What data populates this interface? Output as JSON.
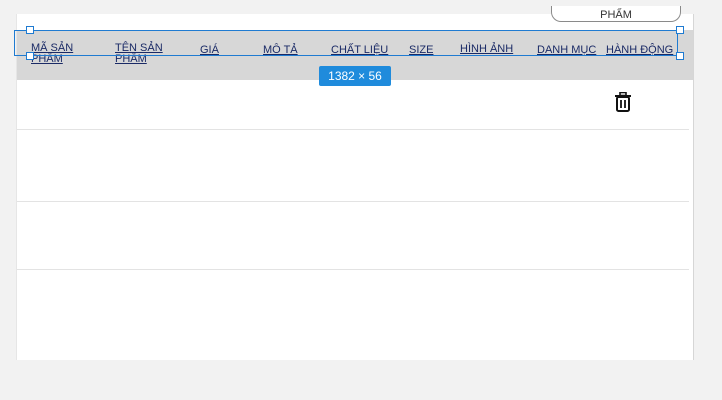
{
  "top_button": {
    "label": "PHẨM"
  },
  "table": {
    "headers": [
      {
        "label": "MÃ SẢN PHẨM"
      },
      {
        "label": "TÊN SẢN PHẨM"
      },
      {
        "label": "GIÁ"
      },
      {
        "label": "MÔ TẢ"
      },
      {
        "label": "CHẤT LIỆU"
      },
      {
        "label": "SIZE"
      },
      {
        "label": "HÌNH ẢNH"
      },
      {
        "label": "DANH MỤC"
      },
      {
        "label": "HÀNH ĐỘNG"
      }
    ]
  },
  "selection": {
    "dimensions": "1382 × 56"
  },
  "icons": {
    "delete": "trash-icon"
  },
  "colors": {
    "header_bg": "#d7d7d7",
    "selection": "#1f7bd1",
    "badge": "#1f8bdc"
  }
}
